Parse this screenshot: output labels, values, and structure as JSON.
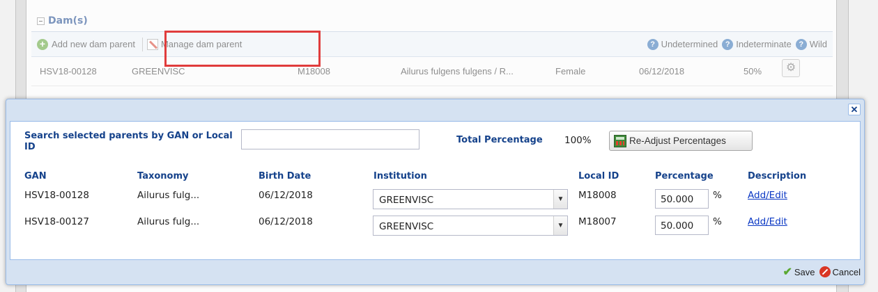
{
  "dam_section": {
    "title": "Dam(s)",
    "add_label": "Add new dam parent",
    "manage_label": "Manage dam parent",
    "legend": [
      "Undetermined",
      "Indeterminate",
      "Wild"
    ],
    "row": {
      "gan": "HSV18-00128",
      "institution": "GREENVISC",
      "local_id": "M18008",
      "taxonomy": "Ailurus fulgens fulgens / R...",
      "sex": "Female",
      "birth_date": "06/12/2018",
      "percentage": "50%"
    }
  },
  "dialog": {
    "search_label": "Search selected parents by GAN or Local ID",
    "search_value": "",
    "total_label": "Total Percentage",
    "total_value": "100%",
    "readjust_label": "Re-Adjust Percentages",
    "headers": [
      "GAN",
      "Taxonomy",
      "Birth Date",
      "Institution",
      "Local ID",
      "Percentage",
      "Description"
    ],
    "rows": [
      {
        "gan": "HSV18-00128",
        "taxonomy": "Ailurus fulg...",
        "birth_date": "06/12/2018",
        "institution": "GREENVISC",
        "local_id": "M18008",
        "percentage": "50.000",
        "unit": "%",
        "description": "Add/Edit"
      },
      {
        "gan": "HSV18-00127",
        "taxonomy": "Ailurus fulg...",
        "birth_date": "06/12/2018",
        "institution": "GREENVISC",
        "local_id": "M18007",
        "percentage": "50.000",
        "unit": "%",
        "description": "Add/Edit"
      }
    ],
    "save_label": "Save",
    "cancel_label": "Cancel"
  },
  "colors": {
    "highlight": "#e03c3c",
    "header_text": "#15428b",
    "link": "#0b38c4"
  }
}
